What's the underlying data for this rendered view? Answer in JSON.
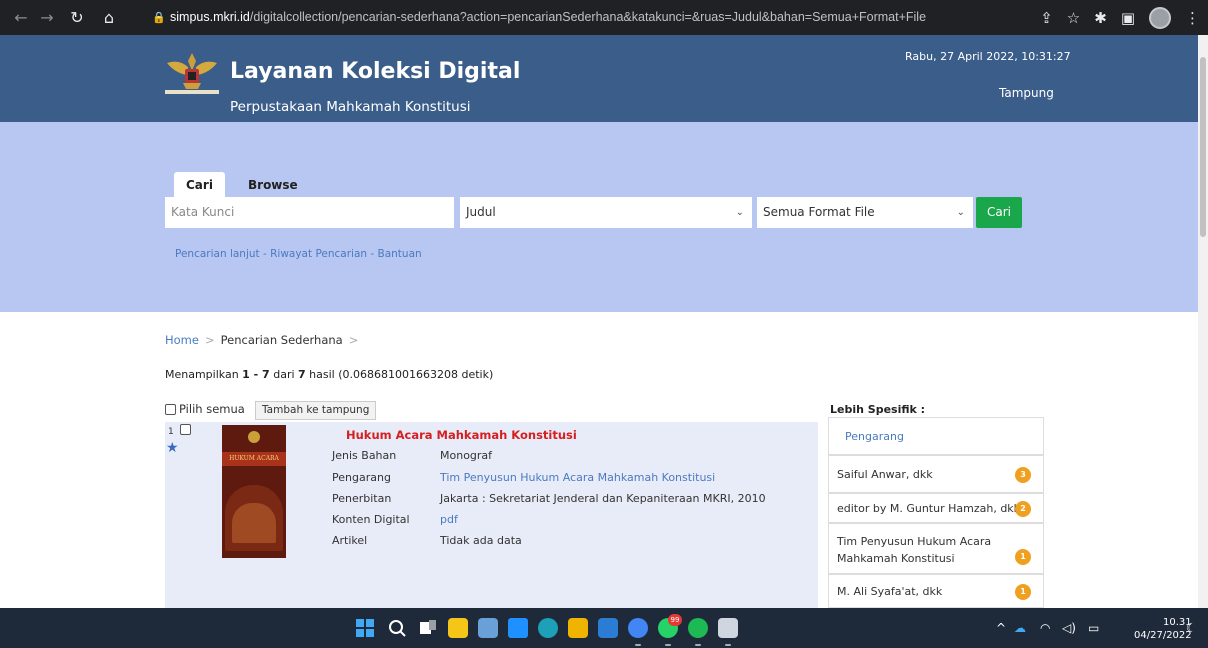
{
  "browser": {
    "url_host": "simpus.mkri.id",
    "url_path": "/digitalcollection/pencarian-sederhana?action=pencarianSederhana&katakunci=&ruas=Judul&bahan=Semua+Format+File"
  },
  "header": {
    "title": "Layanan Koleksi Digital",
    "subtitle": "Perpustakaan Mahkamah Konstitusi",
    "datetime": "Rabu, 27 April 2022, 10:31:27",
    "tampung_link": "Tampung"
  },
  "search": {
    "tabs": [
      "Cari",
      "Browse"
    ],
    "keyword_placeholder": "Kata Kunci",
    "field_select": "Judul",
    "format_select": "Semua Format File",
    "submit_label": "Cari",
    "links": "Pencarian lanjut - Riwayat Pencarian - Bantuan"
  },
  "breadcrumb": {
    "home": "Home",
    "sep": ">",
    "current": "Pencarian Sederhana"
  },
  "summary": {
    "prefix": "Menampilkan ",
    "range": "1 - 7",
    "middle": " dari ",
    "total": "7",
    "suffix": " hasil (0.068681001663208 detik)"
  },
  "bulk": {
    "select_all": "Pilih semua",
    "add_button": "Tambah ke tampung"
  },
  "result": {
    "number": "1",
    "cover_text": "HUKUM ACARA",
    "title": "Hukum Acara Mahkamah Konstitusi",
    "fields": [
      {
        "label": "Jenis Bahan",
        "value": "Monograf"
      },
      {
        "label": "Pengarang",
        "value": "Tim Penyusun Hukum Acara Mahkamah Konstitusi"
      },
      {
        "label": "Penerbitan",
        "value": "Jakarta : Sekretariat Jenderal dan Kepaniteraan MKRI, 2010"
      },
      {
        "label": "Konten Digital",
        "value": "pdf"
      },
      {
        "label": "Artikel",
        "value": "Tidak ada data"
      }
    ]
  },
  "facets": {
    "heading": "Lebih Spesifik :",
    "group": "Pengarang",
    "items": [
      {
        "label": "Saiful Anwar, dkk",
        "count": "3"
      },
      {
        "label": "editor by M. Guntur Hamzah, dkk",
        "count": "2"
      },
      {
        "label": "Tim Penyusun Hukum Acara Mahkamah Konstitusi",
        "count": "1"
      },
      {
        "label": "M. Ali Syafa'at, dkk",
        "count": "1"
      }
    ]
  },
  "taskbar": {
    "time": "10.31",
    "date": "04/27/2022",
    "whatsapp_badge": "99"
  }
}
